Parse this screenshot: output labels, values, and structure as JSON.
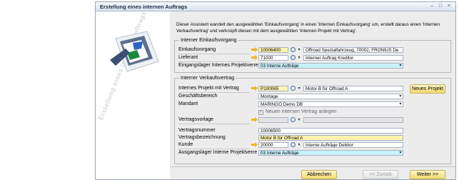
{
  "window": {
    "title": "Erstellung eines internen Auftrags",
    "minimize": "–",
    "maximize": "□",
    "close": "×"
  },
  "watermark": "Erstellung eines internen Auftrags",
  "description": "Dieser Assistent wandelt den ausgewählten 'Einkaufsvorgang' in einen 'Internen Einkaufsvorgang' um, erstellt daraus einen 'Internen Verkaufsvertrag' und verknüpft diesen mit dem ausgewählten 'Internen Projekt mit Vertrag'.",
  "einkauf": {
    "legend": "Interner Einkaufsvorgang",
    "einkaufsvorgang_label": "Einkaufsvorgang",
    "einkaufsvorgang_value": "10006400",
    "einkaufsvorgang_info": "Offroad Spezialfahrzeug, 70002, FRONIUS De",
    "lieferant_label": "Lieferant",
    "lieferant_value": "71000",
    "lieferant_info": "Interner Auftrag Kreditor",
    "lager_label": "Eingangslager Internes Projektverrec",
    "lager_value": "03 Interne Aufträge"
  },
  "verkauf": {
    "legend": "Interner Verkaufsvertrag",
    "projekt_label": "Internes Projekt mit Vertrag",
    "projekt_value": "P100065",
    "projekt_info": "Motor B für Offroad A",
    "neues_projekt": "Neues Projekt",
    "geschaeftsbereich_label": "Geschäftsbereich",
    "geschaeftsbereich_value": "Montage",
    "mandant_label": "Mandant",
    "mandant_value": "MARINGO Demo DB",
    "neuer_vertrag_label": "Neuen internen Vertrag anlegen",
    "vertragsvorlage_label": "Vertragsvorlage",
    "vertragsvorlage_value": "",
    "vertragsnummer_label": "Vertragsnummer",
    "vertragsnummer_value": "10006500",
    "bezeichnung_label": "Vertragsbezeichnung",
    "bezeichnung_value": "Motor B für Offroad A",
    "kunde_label": "Kunde",
    "kunde_value": "20000",
    "kunde_info": "Interne Aufträge Debitor",
    "ausgangslager_label": "Ausgangslager Interne Projektverre",
    "ausgangslager_value": "03 Interne Aufträge"
  },
  "buttons": {
    "abbrechen": "Abbrechen",
    "zurueck": "<< Zurück",
    "weiter": "Weiter >>"
  },
  "colors": {
    "button_yellow": "#f4d96c",
    "field_yellow": "#fff3b0",
    "field_cyan": "#c8f2fb",
    "arrow": "#f3b31b"
  }
}
